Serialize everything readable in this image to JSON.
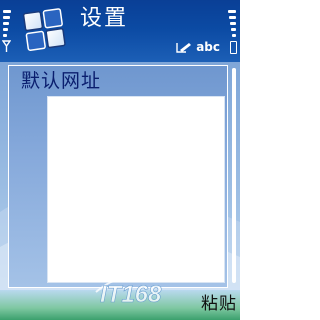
{
  "header": {
    "title": "设置",
    "input_mode": "abc",
    "app_icon": "settings-grid-icon",
    "signal_icon": "antenna-icon",
    "battery_icon": "battery-icon",
    "pen_icon": "pen-icon"
  },
  "form": {
    "field_label": "默认网址",
    "field_value": ""
  },
  "softkeys": {
    "right": "粘贴"
  },
  "watermark": {
    "text": "IT168"
  },
  "colors": {
    "title_bar": "#0b4aa3",
    "label_text": "#0a1e6e",
    "panel_bg": "#86a9db",
    "softkey_bar": "#7fc8a2"
  }
}
